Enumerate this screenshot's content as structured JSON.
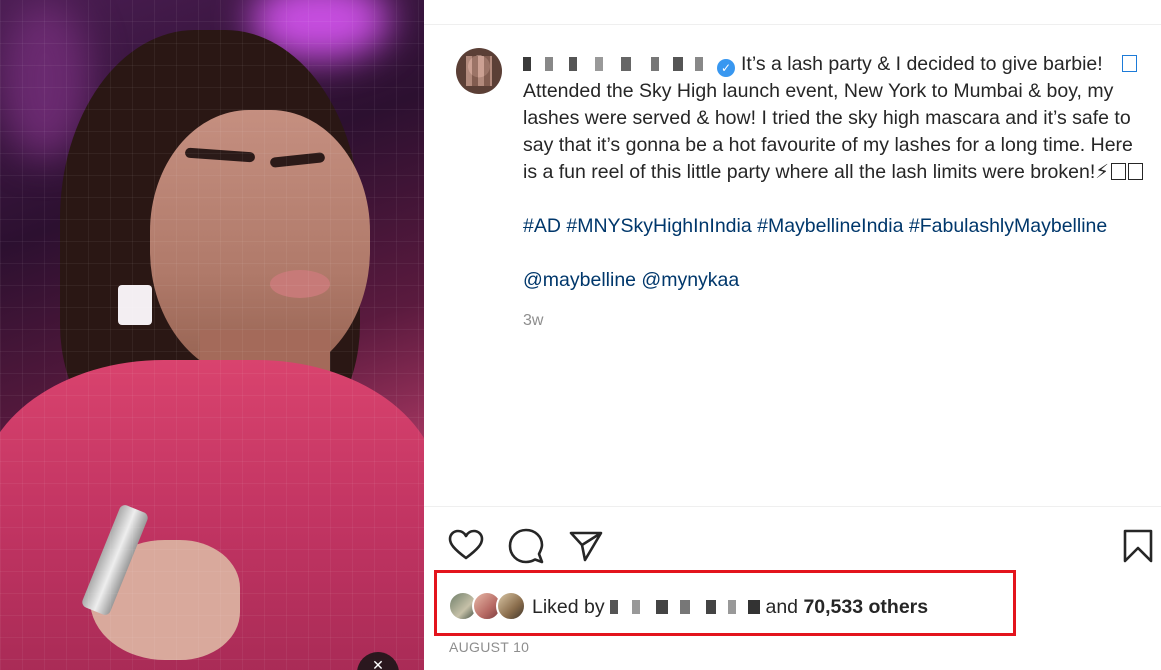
{
  "post": {
    "caption": {
      "line1": "It’s a lash party & I decided to give barbie!",
      "body": "Attended the Sky High launch event, New York to Mumbai & boy, my lashes were served & how! I tried the sky high mascara and it’s safe to say that it’s gonna be a hot favourite of my lashes for a long time. Here is a fun reel of this little party where all the lash limits were broken!",
      "emoji_tail": "⚡",
      "hashtags": "#AD #MNYSkyHighInIndia #MaybellineIndia #FabulashlyMaybelline",
      "mentions": "@maybelline @mynykaa",
      "time_ago": "3w"
    },
    "actions": {
      "like": "heart-icon",
      "comment": "comment-icon",
      "share": "send-icon",
      "save": "bookmark-icon"
    },
    "likes": {
      "prefix": "Liked by",
      "conjunction": "and",
      "count_text": "70,533 others"
    },
    "date": "AUGUST 10"
  },
  "colors": {
    "link": "#00376b",
    "verified": "#3897f0",
    "highlight": "#e3141d",
    "muted": "#8e8e8e"
  }
}
